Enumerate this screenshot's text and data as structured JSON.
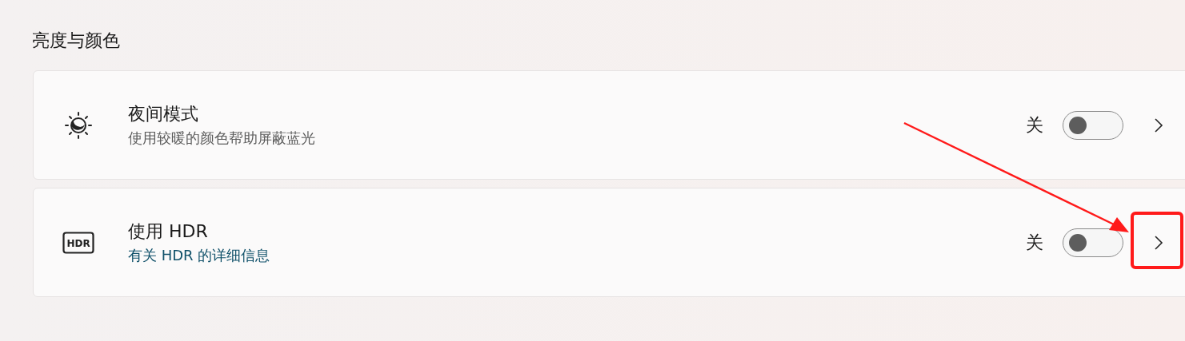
{
  "section": {
    "title": "亮度与颜色"
  },
  "settings": [
    {
      "kind": "night-light",
      "title": "夜间模式",
      "subtitle": "使用较暖的颜色帮助屏蔽蓝光",
      "link": false,
      "state_label": "关",
      "on": false
    },
    {
      "kind": "hdr",
      "icon_text": "HDR",
      "title": "使用 HDR",
      "subtitle": "有关 HDR 的详细信息",
      "link": true,
      "state_label": "关",
      "on": false
    }
  ],
  "annotation": {
    "kind": "arrow-to-box"
  }
}
